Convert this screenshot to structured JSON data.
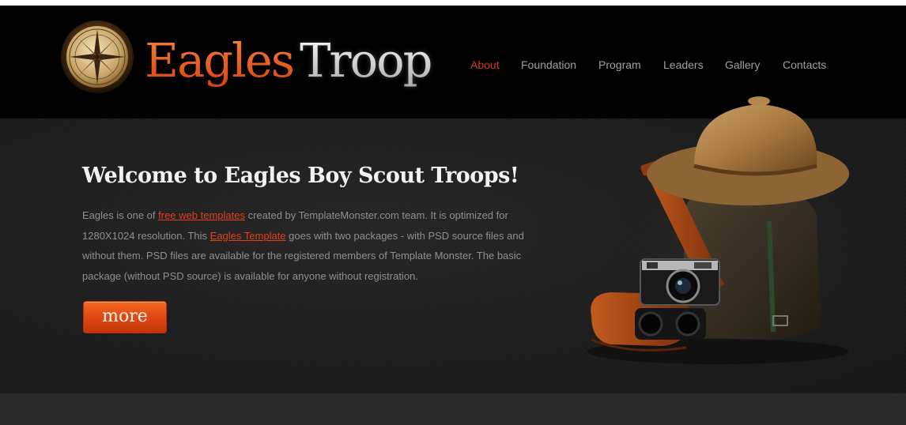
{
  "logo": {
    "word1": "Eagles",
    "word2": "Troop",
    "emblem_icon": "compass-icon"
  },
  "nav": {
    "items": [
      {
        "label": "About",
        "active": true
      },
      {
        "label": "Foundation",
        "active": false
      },
      {
        "label": "Program",
        "active": false
      },
      {
        "label": "Leaders",
        "active": false
      },
      {
        "label": "Gallery",
        "active": false
      },
      {
        "label": "Contacts",
        "active": false
      }
    ]
  },
  "hero": {
    "heading": "Welcome to Eagles Boy Scout Troops!",
    "paragraph": {
      "t1": "Eagles is one of ",
      "link1": "free web templates",
      "t2": " created by TemplateMonster.com team. It is optimized for 1280X1024 resolution. This ",
      "link2": "Eagles Template",
      "t3": " goes with two packages - with PSD source files and without them. PSD files are available for the registered members of Template Monster. The basic package (without PSD source) is available for anyone without registration."
    },
    "more_label": "more",
    "illustration_icon": "scout-gear-icon"
  },
  "colors": {
    "accent": "#e9571b",
    "active_nav": "#d9341c",
    "header_bg": "#000000",
    "hero_bg": "#1f1f1f"
  }
}
